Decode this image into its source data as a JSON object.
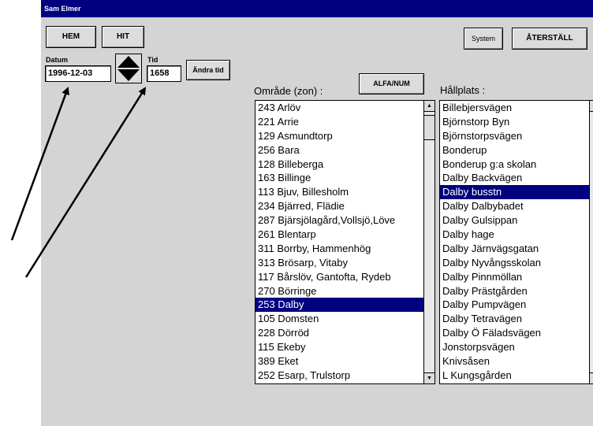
{
  "window": {
    "title": "Sam Elmer"
  },
  "toolbar": {
    "hem_label": "HEM",
    "hit_label": "HIT",
    "system_label": "System",
    "reset_label": "ÅTERSTÄLL"
  },
  "date": {
    "label": "Datum",
    "value": "1996-12-03"
  },
  "time": {
    "label": "Tid",
    "value": "1658",
    "change_label": "Ändra tid"
  },
  "sort_button": {
    "label": "ALFA/NUM"
  },
  "zone_list": {
    "header": "Område (zon) :",
    "selected": "253 Dalby",
    "items": [
      "243 Arlöv",
      "221 Arrie",
      "129 Asmundtorp",
      "256 Bara",
      "128 Billeberga",
      "163 Billinge",
      "113 Bjuv, Billesholm",
      "234 Bjärred, Flädie",
      "287 Bjärsjölagård,Vollsjö,Löve",
      "261 Blentarp",
      "311 Borrby, Hammenhög",
      "313 Brösarp, Vitaby",
      "117 Bårslöv, Gantofta, Rydeb",
      "270 Börringe",
      "253 Dalby",
      "105 Domsten",
      "228 Dörröd",
      "115 Ekeby",
      "389 Eket",
      "252 Esarp, Trulstorp"
    ]
  },
  "stop_list": {
    "header": "Hållplats :",
    "selected": "Dalby busstn",
    "items": [
      "Billebjersvägen",
      "Björnstorp Byn",
      "Björnstorpsvägen",
      "Bonderup",
      "Bonderup g:a skolan",
      "Dalby Backvägen",
      "Dalby busstn",
      "Dalby Dalbybadet",
      "Dalby Gulsippan",
      "Dalby hage",
      "Dalby Järnvägsgatan",
      "Dalby Nyvångsskolan",
      "Dalby Pinnmöllan",
      "Dalby Prästgården",
      "Dalby Pumpvägen",
      "Dalby Tetravägen",
      "Dalby Ö Fäladsvägen",
      "Jonstorpsvägen",
      "Knivsåsen",
      "L Kungsgården"
    ]
  },
  "colors": {
    "title_bar": "#000080",
    "selection": "#000080",
    "window_bg": "#d4d4d4"
  },
  "icons": {
    "time_stepper": "up-down-arrows-icon",
    "annotation": "arrow-annotation-icon"
  }
}
